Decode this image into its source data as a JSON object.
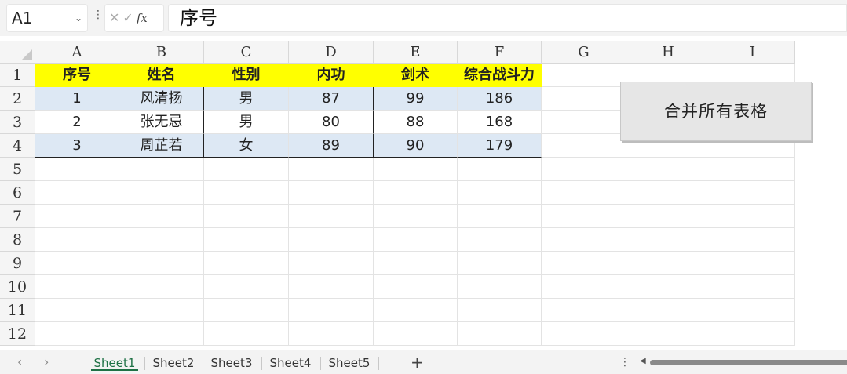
{
  "formula_bar": {
    "name_box": "A1",
    "cancel_icon": "✕",
    "enter_icon": "✓",
    "fx_label": "fx",
    "formula": "序号"
  },
  "columns": [
    "A",
    "B",
    "C",
    "D",
    "E",
    "F",
    "G",
    "H",
    "I"
  ],
  "rows": [
    "1",
    "2",
    "3",
    "4",
    "5",
    "6",
    "7",
    "8",
    "9",
    "10",
    "11",
    "12"
  ],
  "table": {
    "headers": [
      "序号",
      "姓名",
      "性别",
      "内功",
      "剑术",
      "综合战斗力"
    ],
    "data": [
      [
        "1",
        "风清扬",
        "男",
        "87",
        "99",
        "186"
      ],
      [
        "2",
        "张无忌",
        "男",
        "80",
        "88",
        "168"
      ],
      [
        "3",
        "周芷若",
        "女",
        "89",
        "90",
        "179"
      ]
    ]
  },
  "macro_button": {
    "label": "合并所有表格"
  },
  "sheets": [
    "Sheet1",
    "Sheet2",
    "Sheet3",
    "Sheet4",
    "Sheet5"
  ],
  "active_sheet": "Sheet1",
  "colors": {
    "header_fill": "#ffff00",
    "band_fill": "#dde8f4",
    "active_tab": "#1e7145"
  }
}
